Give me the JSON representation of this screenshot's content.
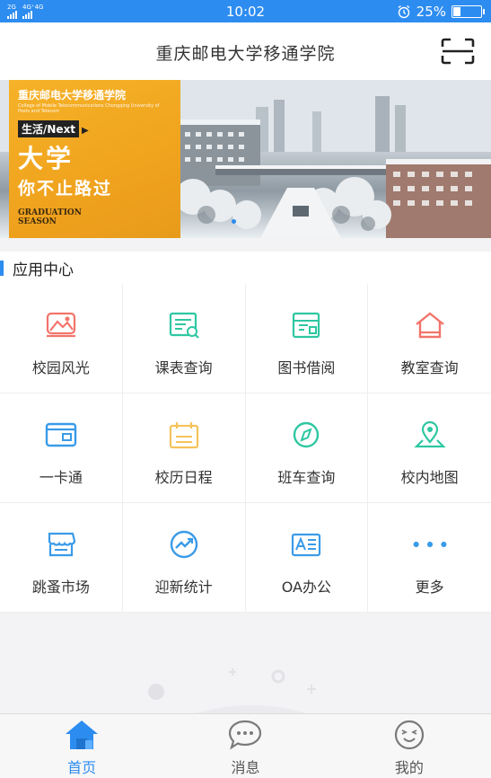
{
  "status_bar": {
    "signal1_label": "2G",
    "signal2_label": "4G⁺4G",
    "time": "10:02",
    "battery_text": "25%",
    "battery_level": 0.25
  },
  "header": {
    "title": "重庆邮电大学移通学院",
    "scan_icon": "scan-icon"
  },
  "banner": {
    "school_name": "重庆邮电大学移通学院",
    "school_english": "College of Mobile Telecommunications Chongqing University of Posts and Telecom",
    "tag": "生活/Next",
    "headline": "大学",
    "subline": "你不止路过",
    "graduation_line1": "GRADUATION",
    "graduation_line2": "SEASON"
  },
  "section": {
    "title": "应用中心"
  },
  "apps": [
    {
      "label": "校园风光",
      "icon": "landscape-icon",
      "color": "#f2746b"
    },
    {
      "label": "课表查询",
      "icon": "timetable-icon",
      "color": "#2ec7a1"
    },
    {
      "label": "图书借阅",
      "icon": "book-icon",
      "color": "#2ec7a1"
    },
    {
      "label": "教室查询",
      "icon": "house-icon",
      "color": "#f2746b"
    },
    {
      "label": "一卡通",
      "icon": "card-icon",
      "color": "#3a9be8"
    },
    {
      "label": "校历日程",
      "icon": "calendar-icon",
      "color": "#f5c35b"
    },
    {
      "label": "班车查询",
      "icon": "compass-icon",
      "color": "#2ec7a1"
    },
    {
      "label": "校内地图",
      "icon": "map-pin-icon",
      "color": "#2ec7a1"
    },
    {
      "label": "跳蚤市场",
      "icon": "shop-icon",
      "color": "#3a9be8"
    },
    {
      "label": "迎新统计",
      "icon": "trend-icon",
      "color": "#3a9be8"
    },
    {
      "label": "OA办公",
      "icon": "contact-card-icon",
      "color": "#3a9be8"
    },
    {
      "label": "更多",
      "icon": "more-dots-icon",
      "color": "#3a9be8"
    }
  ],
  "tabbar": {
    "tabs": [
      {
        "label": "首页",
        "icon": "home-icon",
        "active": true
      },
      {
        "label": "消息",
        "icon": "message-icon",
        "active": false
      },
      {
        "label": "我的",
        "icon": "profile-face-icon",
        "active": false
      }
    ]
  },
  "colors": {
    "accent": "#2d8cf0"
  }
}
